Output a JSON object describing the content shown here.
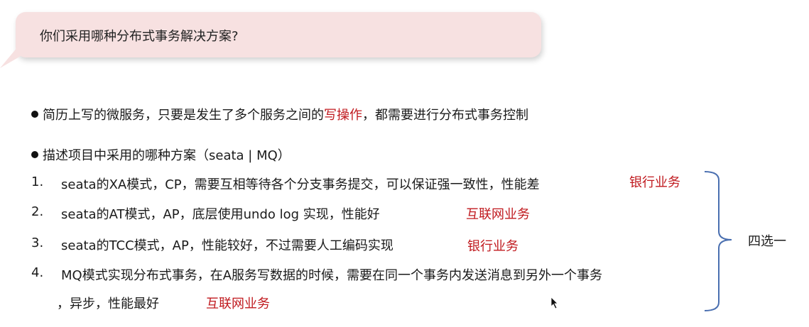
{
  "question": "你们采用哪种分布式事务解决方案?",
  "bullet1": {
    "before": "简历上写的微服务，只要是发生了多个服务之间的",
    "highlight": "写操作",
    "after": "，都需要进行分布式事务控制"
  },
  "bullet2": "描述项目中采用的哪种方案（seata | MQ）",
  "items": [
    {
      "num": "1.",
      "text": "seata的XA模式，CP，需要互相等待各个分支事务提交，可以保证强一致性，性能差",
      "tag": "银行业务"
    },
    {
      "num": "2.",
      "text": "seata的AT模式，AP，底层使用undo log 实现，性能好",
      "tag": "互联网业务"
    },
    {
      "num": "3.",
      "text": "seata的TCC模式，AP，性能较好，不过需要人工编码实现",
      "tag": "银行业务"
    },
    {
      "num": "4.",
      "text": "MQ模式实现分布式事务，在A服务写数据的时候，需要在同一个事务内发送消息到另外一个事务",
      "text2": "，异步，性能最好",
      "tag": "互联网业务"
    }
  ],
  "choice": "四选一",
  "colors": {
    "bubble": "#f7e1e1",
    "highlight": "#c0191e",
    "brace": "#4a6fb0"
  }
}
